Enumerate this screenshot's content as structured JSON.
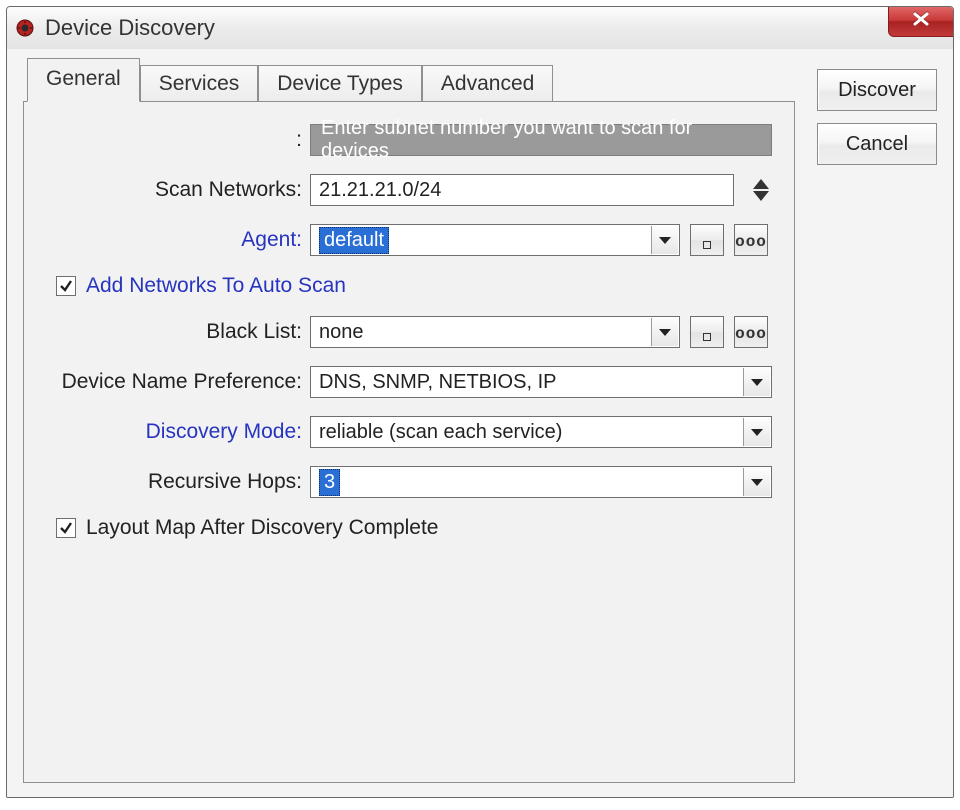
{
  "window": {
    "title": "Device Discovery"
  },
  "tabs": [
    "General",
    "Services",
    "Device Types",
    "Advanced"
  ],
  "active_tab": "General",
  "sidebar": {
    "discover_label": "Discover",
    "cancel_label": "Cancel"
  },
  "general": {
    "hint_label": ":",
    "hint_text": "Enter subnet number you want to scan for devices",
    "scan_networks_label": "Scan Networks:",
    "scan_networks_value": "21.21.21.0/24",
    "agent_label": "Agent:",
    "agent_value": "default",
    "auto_scan_checked": true,
    "auto_scan_label": "Add Networks To Auto Scan",
    "black_list_label": "Black List:",
    "black_list_value": "none",
    "name_pref_label": "Device Name Preference:",
    "name_pref_value": "DNS, SNMP, NETBIOS, IP",
    "discovery_mode_label": "Discovery Mode:",
    "discovery_mode_value": "reliable (scan each service)",
    "recursive_hops_label": "Recursive Hops:",
    "recursive_hops_value": "3",
    "layout_map_checked": true,
    "layout_map_label": "Layout Map After Discovery Complete"
  },
  "icons": {
    "more": "ooo"
  }
}
